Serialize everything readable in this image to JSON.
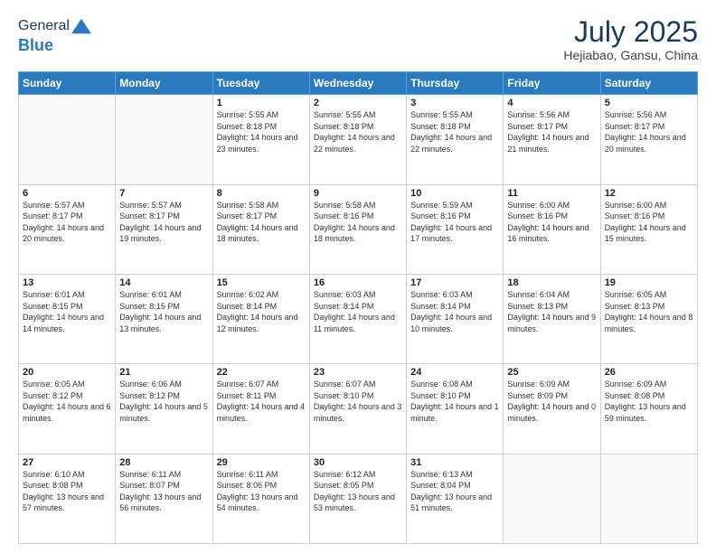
{
  "header": {
    "logo_line1": "General",
    "logo_line2": "Blue",
    "month": "July 2025",
    "location": "Hejiabao, Gansu, China"
  },
  "weekdays": [
    "Sunday",
    "Monday",
    "Tuesday",
    "Wednesday",
    "Thursday",
    "Friday",
    "Saturday"
  ],
  "weeks": [
    [
      {
        "day": "",
        "info": ""
      },
      {
        "day": "",
        "info": ""
      },
      {
        "day": "1",
        "info": "Sunrise: 5:55 AM\nSunset: 8:18 PM\nDaylight: 14 hours and 23 minutes."
      },
      {
        "day": "2",
        "info": "Sunrise: 5:55 AM\nSunset: 8:18 PM\nDaylight: 14 hours and 22 minutes."
      },
      {
        "day": "3",
        "info": "Sunrise: 5:55 AM\nSunset: 8:18 PM\nDaylight: 14 hours and 22 minutes."
      },
      {
        "day": "4",
        "info": "Sunrise: 5:56 AM\nSunset: 8:17 PM\nDaylight: 14 hours and 21 minutes."
      },
      {
        "day": "5",
        "info": "Sunrise: 5:56 AM\nSunset: 8:17 PM\nDaylight: 14 hours and 20 minutes."
      }
    ],
    [
      {
        "day": "6",
        "info": "Sunrise: 5:57 AM\nSunset: 8:17 PM\nDaylight: 14 hours and 20 minutes."
      },
      {
        "day": "7",
        "info": "Sunrise: 5:57 AM\nSunset: 8:17 PM\nDaylight: 14 hours and 19 minutes."
      },
      {
        "day": "8",
        "info": "Sunrise: 5:58 AM\nSunset: 8:17 PM\nDaylight: 14 hours and 18 minutes."
      },
      {
        "day": "9",
        "info": "Sunrise: 5:58 AM\nSunset: 8:16 PM\nDaylight: 14 hours and 18 minutes."
      },
      {
        "day": "10",
        "info": "Sunrise: 5:59 AM\nSunset: 8:16 PM\nDaylight: 14 hours and 17 minutes."
      },
      {
        "day": "11",
        "info": "Sunrise: 6:00 AM\nSunset: 8:16 PM\nDaylight: 14 hours and 16 minutes."
      },
      {
        "day": "12",
        "info": "Sunrise: 6:00 AM\nSunset: 8:16 PM\nDaylight: 14 hours and 15 minutes."
      }
    ],
    [
      {
        "day": "13",
        "info": "Sunrise: 6:01 AM\nSunset: 8:15 PM\nDaylight: 14 hours and 14 minutes."
      },
      {
        "day": "14",
        "info": "Sunrise: 6:01 AM\nSunset: 8:15 PM\nDaylight: 14 hours and 13 minutes."
      },
      {
        "day": "15",
        "info": "Sunrise: 6:02 AM\nSunset: 8:14 PM\nDaylight: 14 hours and 12 minutes."
      },
      {
        "day": "16",
        "info": "Sunrise: 6:03 AM\nSunset: 8:14 PM\nDaylight: 14 hours and 11 minutes."
      },
      {
        "day": "17",
        "info": "Sunrise: 6:03 AM\nSunset: 8:14 PM\nDaylight: 14 hours and 10 minutes."
      },
      {
        "day": "18",
        "info": "Sunrise: 6:04 AM\nSunset: 8:13 PM\nDaylight: 14 hours and 9 minutes."
      },
      {
        "day": "19",
        "info": "Sunrise: 6:05 AM\nSunset: 8:13 PM\nDaylight: 14 hours and 8 minutes."
      }
    ],
    [
      {
        "day": "20",
        "info": "Sunrise: 6:05 AM\nSunset: 8:12 PM\nDaylight: 14 hours and 6 minutes."
      },
      {
        "day": "21",
        "info": "Sunrise: 6:06 AM\nSunset: 8:12 PM\nDaylight: 14 hours and 5 minutes."
      },
      {
        "day": "22",
        "info": "Sunrise: 6:07 AM\nSunset: 8:11 PM\nDaylight: 14 hours and 4 minutes."
      },
      {
        "day": "23",
        "info": "Sunrise: 6:07 AM\nSunset: 8:10 PM\nDaylight: 14 hours and 3 minutes."
      },
      {
        "day": "24",
        "info": "Sunrise: 6:08 AM\nSunset: 8:10 PM\nDaylight: 14 hours and 1 minute."
      },
      {
        "day": "25",
        "info": "Sunrise: 6:09 AM\nSunset: 8:09 PM\nDaylight: 14 hours and 0 minutes."
      },
      {
        "day": "26",
        "info": "Sunrise: 6:09 AM\nSunset: 8:08 PM\nDaylight: 13 hours and 59 minutes."
      }
    ],
    [
      {
        "day": "27",
        "info": "Sunrise: 6:10 AM\nSunset: 8:08 PM\nDaylight: 13 hours and 57 minutes."
      },
      {
        "day": "28",
        "info": "Sunrise: 6:11 AM\nSunset: 8:07 PM\nDaylight: 13 hours and 56 minutes."
      },
      {
        "day": "29",
        "info": "Sunrise: 6:11 AM\nSunset: 8:06 PM\nDaylight: 13 hours and 54 minutes."
      },
      {
        "day": "30",
        "info": "Sunrise: 6:12 AM\nSunset: 8:05 PM\nDaylight: 13 hours and 53 minutes."
      },
      {
        "day": "31",
        "info": "Sunrise: 6:13 AM\nSunset: 8:04 PM\nDaylight: 13 hours and 51 minutes."
      },
      {
        "day": "",
        "info": ""
      },
      {
        "day": "",
        "info": ""
      }
    ]
  ]
}
